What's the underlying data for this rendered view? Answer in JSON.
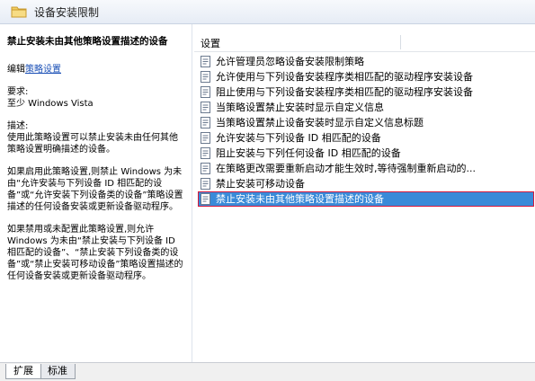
{
  "window": {
    "title": "设备安装限制"
  },
  "left_pane": {
    "setting_title": "禁止安装未由其他策略设置描述的设备",
    "edit_prefix": "编辑",
    "edit_link": "策略设置",
    "requirement_label": "要求:",
    "requirement_value": "至少 Windows Vista",
    "description_label": "描述:",
    "paragraphs": [
      "使用此策略设置可以禁止安装未由任何其他策略设置明确描述的设备。",
      "如果启用此策略设置,则禁止 Windows 为未由“允许安装与下列设备 ID 相匹配的设备”或“允许安装下列设备类的设备”策略设置描述的任何设备安装或更新设备驱动程序。",
      "如果禁用或未配置此策略设置,则允许 Windows 为未由“禁止安装与下列设备 ID 相匹配的设备”、“禁止安装下列设备类的设备”或“禁止安装可移动设备”策略设置描述的任何设备安装或更新设备驱动程序。"
    ]
  },
  "right_pane": {
    "column_header": "设置",
    "items": [
      {
        "label": "允许管理员忽略设备安装限制策略",
        "selected": false
      },
      {
        "label": "允许使用与下列设备安装程序类相匹配的驱动程序安装设备",
        "selected": false
      },
      {
        "label": "阻止使用与下列设备安装程序类相匹配的驱动程序安装设备",
        "selected": false
      },
      {
        "label": "当策略设置禁止安装时显示自定义信息",
        "selected": false
      },
      {
        "label": "当策略设置禁止设备安装时显示自定义信息标题",
        "selected": false
      },
      {
        "label": "允许安装与下列设备 ID 相匹配的设备",
        "selected": false
      },
      {
        "label": "阻止安装与下列任何设备 ID 相匹配的设备",
        "selected": false
      },
      {
        "label": "在策略更改需要重新启动才能生效时,等待强制重新启动的...",
        "selected": false
      },
      {
        "label": "禁止安装可移动设备",
        "selected": false
      },
      {
        "label": "禁止安装未由其他策略设置描述的设备",
        "selected": true
      }
    ]
  },
  "tabs": [
    {
      "label": "扩展",
      "active": true
    },
    {
      "label": "标准",
      "active": false
    }
  ],
  "colors": {
    "selection": "#3a8ad8",
    "selection_border": "#d7183c",
    "link": "#1a4fb6"
  }
}
